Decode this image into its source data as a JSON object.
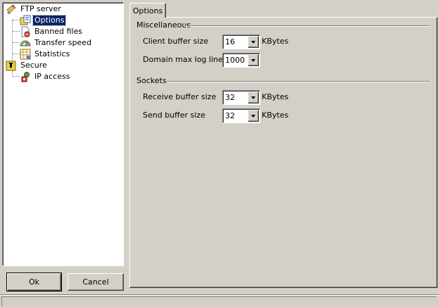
{
  "tree": {
    "root": {
      "label": "FTP server",
      "icon": "ftp-server-icon"
    },
    "children": [
      {
        "label": "Options",
        "icon": "options-icon",
        "selected": true
      },
      {
        "label": "Banned files",
        "icon": "banned-files-icon"
      },
      {
        "label": "Transfer speed",
        "icon": "transfer-speed-icon"
      },
      {
        "label": "Statistics",
        "icon": "statistics-icon"
      }
    ],
    "secure": {
      "label": "Secure",
      "icon": "lock-icon"
    },
    "secure_children": [
      {
        "label": "IP access",
        "icon": "ip-access-icon"
      }
    ]
  },
  "buttons": {
    "ok": "Ok",
    "cancel": "Cancel"
  },
  "tabs": [
    {
      "label": "Options",
      "active": true
    }
  ],
  "miscellaneous": {
    "title": "Miscellaneous",
    "client_buffer": {
      "label": "Client buffer size",
      "value": "16",
      "unit": "KBytes"
    },
    "domain_log": {
      "label": "Domain max log lines",
      "value": "1000"
    }
  },
  "sockets": {
    "title": "Sockets",
    "receive_buffer": {
      "label": "Receive buffer size",
      "value": "32",
      "unit": "KBytes"
    },
    "send_buffer": {
      "label": "Send buffer size",
      "value": "32",
      "unit": "KBytes"
    }
  }
}
